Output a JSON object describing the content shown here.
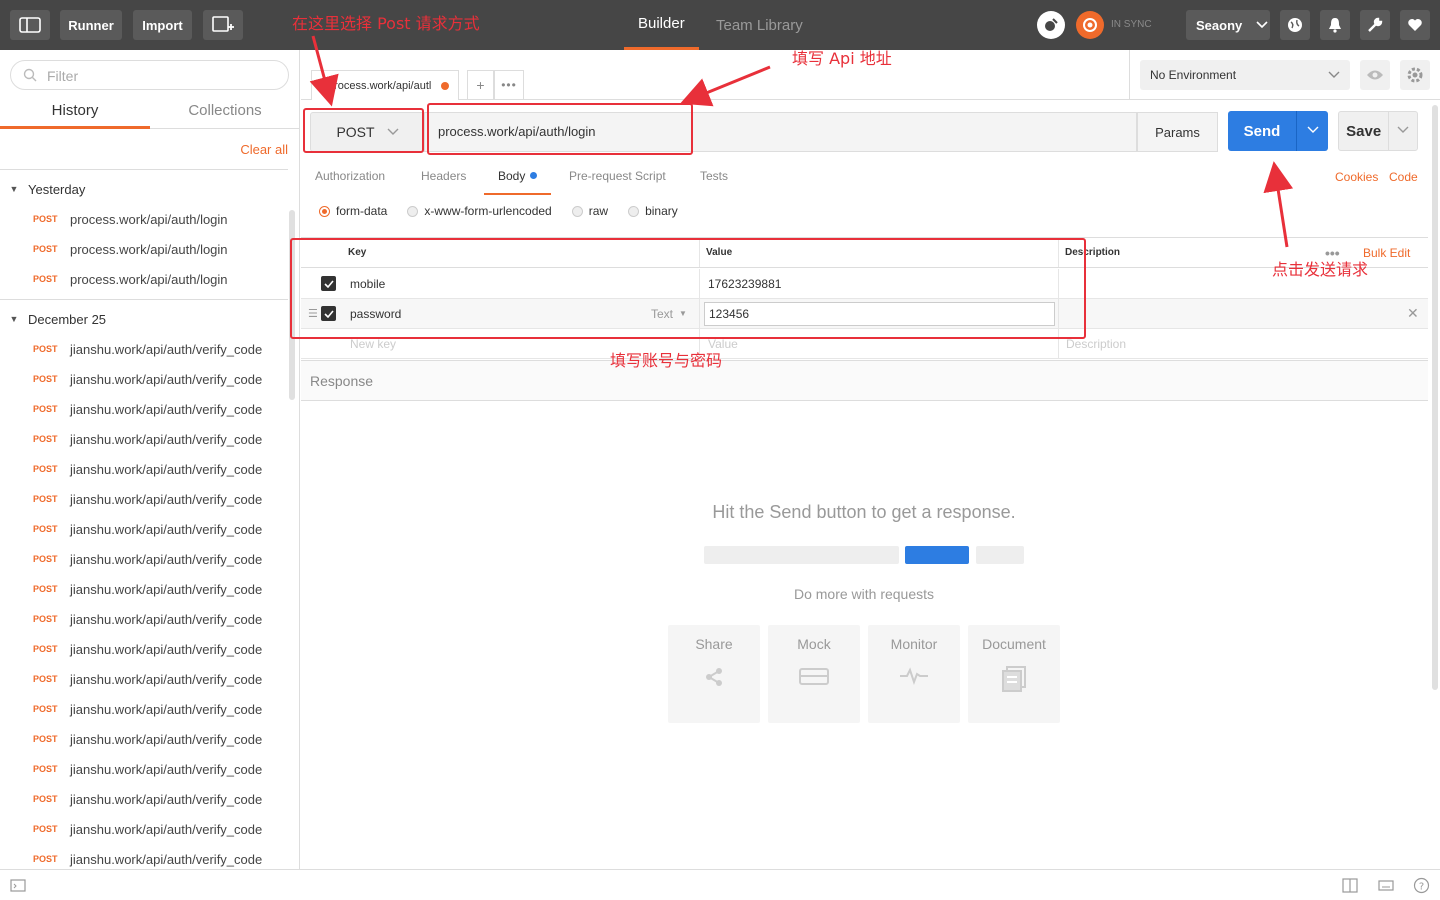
{
  "topbar": {
    "runner": "Runner",
    "import": "Import",
    "tabs": [
      "Builder",
      "Team Library"
    ],
    "sync": "IN SYNC",
    "user": "Seaony"
  },
  "sidebar": {
    "filter_placeholder": "Filter",
    "tabs": [
      "History",
      "Collections"
    ],
    "clear_all": "Clear all",
    "groups": [
      {
        "label": "Yesterday",
        "items": [
          {
            "method": "POST",
            "url": "process.work/api/auth/login"
          },
          {
            "method": "POST",
            "url": "process.work/api/auth/login"
          },
          {
            "method": "POST",
            "url": "process.work/api/auth/login"
          }
        ]
      },
      {
        "label": "December 25",
        "items": [
          {
            "method": "POST",
            "url": "jianshu.work/api/auth/verify_code"
          },
          {
            "method": "POST",
            "url": "jianshu.work/api/auth/verify_code"
          },
          {
            "method": "POST",
            "url": "jianshu.work/api/auth/verify_code"
          },
          {
            "method": "POST",
            "url": "jianshu.work/api/auth/verify_code"
          },
          {
            "method": "POST",
            "url": "jianshu.work/api/auth/verify_code"
          },
          {
            "method": "POST",
            "url": "jianshu.work/api/auth/verify_code"
          },
          {
            "method": "POST",
            "url": "jianshu.work/api/auth/verify_code"
          },
          {
            "method": "POST",
            "url": "jianshu.work/api/auth/verify_code"
          },
          {
            "method": "POST",
            "url": "jianshu.work/api/auth/verify_code"
          },
          {
            "method": "POST",
            "url": "jianshu.work/api/auth/verify_code"
          },
          {
            "method": "POST",
            "url": "jianshu.work/api/auth/verify_code"
          },
          {
            "method": "POST",
            "url": "jianshu.work/api/auth/verify_code"
          },
          {
            "method": "POST",
            "url": "jianshu.work/api/auth/verify_code"
          },
          {
            "method": "POST",
            "url": "jianshu.work/api/auth/verify_code"
          },
          {
            "method": "POST",
            "url": "jianshu.work/api/auth/verify_code"
          },
          {
            "method": "POST",
            "url": "jianshu.work/api/auth/verify_code"
          },
          {
            "method": "POST",
            "url": "jianshu.work/api/auth/verify_code"
          },
          {
            "method": "POST",
            "url": "jianshu.work/api/auth/verify_code"
          }
        ]
      }
    ]
  },
  "request_tab": {
    "label": "process.work/api/autl"
  },
  "environment": {
    "selected": "No Environment"
  },
  "request": {
    "method": "POST",
    "url": "process.work/api/auth/login",
    "params": "Params",
    "send": "Send",
    "save": "Save"
  },
  "subtabs": [
    "Authorization",
    "Headers",
    "Body",
    "Pre-request Script",
    "Tests"
  ],
  "links": {
    "cookies": "Cookies",
    "code": "Code",
    "bulk_edit": "Bulk Edit"
  },
  "body_modes": [
    "form-data",
    "x-www-form-urlencoded",
    "raw",
    "binary"
  ],
  "table": {
    "headers": {
      "key": "Key",
      "value": "Value",
      "description": "Description"
    },
    "rows": [
      {
        "key": "mobile",
        "value": "17623239881"
      },
      {
        "key": "password",
        "value": "123456",
        "type": "Text"
      }
    ],
    "placeholders": {
      "key": "New key",
      "value": "Value",
      "description": "Description"
    }
  },
  "response": {
    "label": "Response",
    "hint": "Hit the Send button to get a response.",
    "do_more": "Do more with requests",
    "cards": [
      "Share",
      "Mock",
      "Monitor",
      "Document"
    ]
  },
  "annotations": {
    "method": "在这里选择 Post 请求方式",
    "url": "填写 Api 地址",
    "send": "点击发送请求",
    "params": "填写账号与密码"
  },
  "colors": {
    "accent": "#ef6a2b",
    "send": "#2d7de2",
    "annotation": "#e8303a",
    "topbar": "#464646"
  }
}
